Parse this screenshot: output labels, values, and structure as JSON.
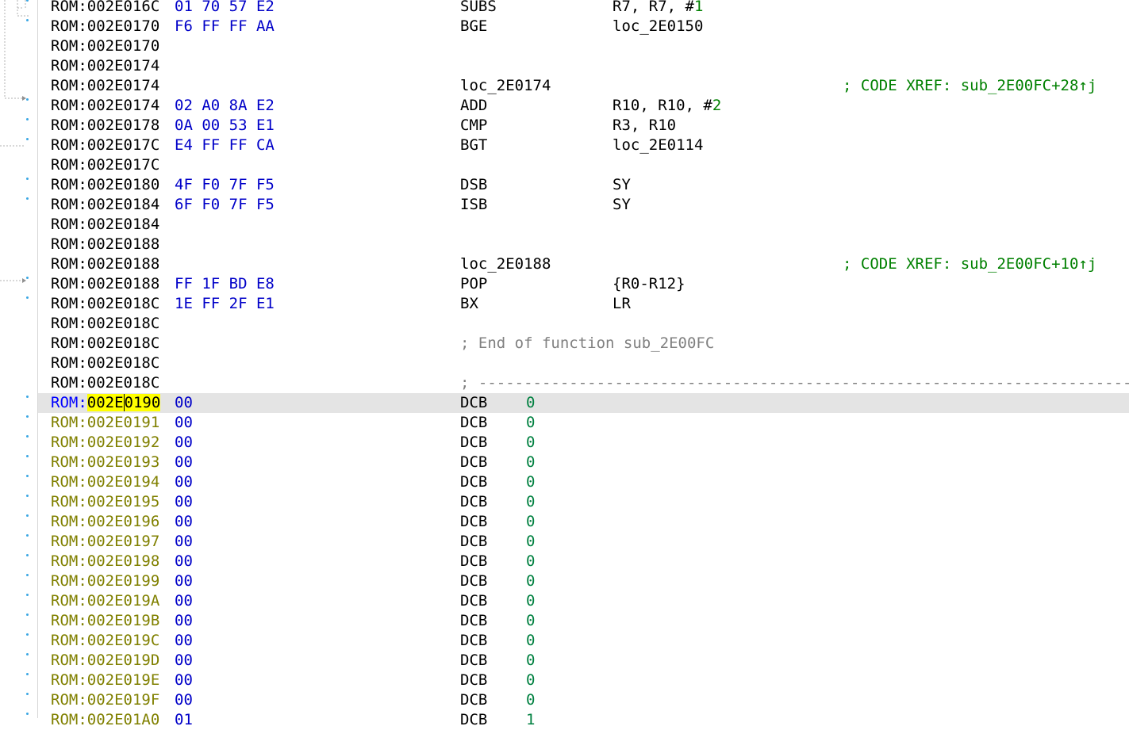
{
  "segment": "ROM",
  "rows": [
    {
      "off": "002E016C",
      "bytes": "01 70 57 E2",
      "mn": "SUBS",
      "ops": [
        {
          "t": "R7, R7, #"
        },
        {
          "n": "1"
        }
      ]
    },
    {
      "off": "002E0170",
      "bytes": "F6 FF FF AA",
      "mn": "BGE",
      "ops": [
        {
          "t": "loc_2E0150"
        }
      ]
    },
    {
      "off": "002E0170"
    },
    {
      "off": "002E0174"
    },
    {
      "off": "002E0174",
      "label": "loc_2E0174",
      "xref": "; CODE XREF: sub_2E00FC+28↑j"
    },
    {
      "off": "002E0174",
      "bytes": "02 A0 8A E2",
      "mn": "ADD",
      "ops": [
        {
          "t": "R10, R10, #"
        },
        {
          "n": "2"
        }
      ]
    },
    {
      "off": "002E0178",
      "bytes": "0A 00 53 E1",
      "mn": "CMP",
      "ops": [
        {
          "t": "R3, R10"
        }
      ]
    },
    {
      "off": "002E017C",
      "bytes": "E4 FF FF CA",
      "mn": "BGT",
      "ops": [
        {
          "t": "loc_2E0114"
        }
      ]
    },
    {
      "off": "002E017C"
    },
    {
      "off": "002E0180",
      "bytes": "4F F0 7F F5",
      "mn": "DSB",
      "ops": [
        {
          "t": "SY"
        }
      ]
    },
    {
      "off": "002E0184",
      "bytes": "6F F0 7F F5",
      "mn": "ISB",
      "ops": [
        {
          "t": "SY"
        }
      ]
    },
    {
      "off": "002E0184"
    },
    {
      "off": "002E0188"
    },
    {
      "off": "002E0188",
      "label": "loc_2E0188",
      "xref": "; CODE XREF: sub_2E00FC+10↑j"
    },
    {
      "off": "002E0188",
      "bytes": "FF 1F BD E8",
      "mn": "POP",
      "ops": [
        {
          "t": "{R0-R12}"
        }
      ]
    },
    {
      "off": "002E018C",
      "bytes": "1E FF 2F E1",
      "mn": "BX",
      "ops": [
        {
          "t": "LR"
        }
      ]
    },
    {
      "off": "002E018C"
    },
    {
      "off": "002E018C",
      "comment": "; End of function sub_2E00FC"
    },
    {
      "off": "002E018C"
    },
    {
      "off": "002E018C",
      "sep": "; ----------------------------------------------------------------------------"
    },
    {
      "off": "002E0190",
      "bytes": "00",
      "mn": "DCB",
      "val": "0",
      "data": true,
      "current": true
    },
    {
      "off": "002E0191",
      "bytes": "00",
      "mn": "DCB",
      "val": "0",
      "data": true
    },
    {
      "off": "002E0192",
      "bytes": "00",
      "mn": "DCB",
      "val": "0",
      "data": true
    },
    {
      "off": "002E0193",
      "bytes": "00",
      "mn": "DCB",
      "val": "0",
      "data": true
    },
    {
      "off": "002E0194",
      "bytes": "00",
      "mn": "DCB",
      "val": "0",
      "data": true
    },
    {
      "off": "002E0195",
      "bytes": "00",
      "mn": "DCB",
      "val": "0",
      "data": true
    },
    {
      "off": "002E0196",
      "bytes": "00",
      "mn": "DCB",
      "val": "0",
      "data": true
    },
    {
      "off": "002E0197",
      "bytes": "00",
      "mn": "DCB",
      "val": "0",
      "data": true
    },
    {
      "off": "002E0198",
      "bytes": "00",
      "mn": "DCB",
      "val": "0",
      "data": true
    },
    {
      "off": "002E0199",
      "bytes": "00",
      "mn": "DCB",
      "val": "0",
      "data": true
    },
    {
      "off": "002E019A",
      "bytes": "00",
      "mn": "DCB",
      "val": "0",
      "data": true
    },
    {
      "off": "002E019B",
      "bytes": "00",
      "mn": "DCB",
      "val": "0",
      "data": true
    },
    {
      "off": "002E019C",
      "bytes": "00",
      "mn": "DCB",
      "val": "0",
      "data": true
    },
    {
      "off": "002E019D",
      "bytes": "00",
      "mn": "DCB",
      "val": "0",
      "data": true
    },
    {
      "off": "002E019E",
      "bytes": "00",
      "mn": "DCB",
      "val": "0",
      "data": true
    },
    {
      "off": "002E019F",
      "bytes": "00",
      "mn": "DCB",
      "val": "0",
      "data": true
    },
    {
      "off": "002E01A0",
      "bytes": "01",
      "mn": "DCB",
      "val": "1",
      "data": true
    }
  ],
  "colors": {
    "address": "#000000",
    "data_address": "#808000",
    "bytes": "#0000c8",
    "number": "#008000",
    "xref": "#008000",
    "comment": "#808080",
    "selection": "#ffff00",
    "current_line": "#e4e4e4",
    "gutter_marker": "#3aa7e4"
  }
}
